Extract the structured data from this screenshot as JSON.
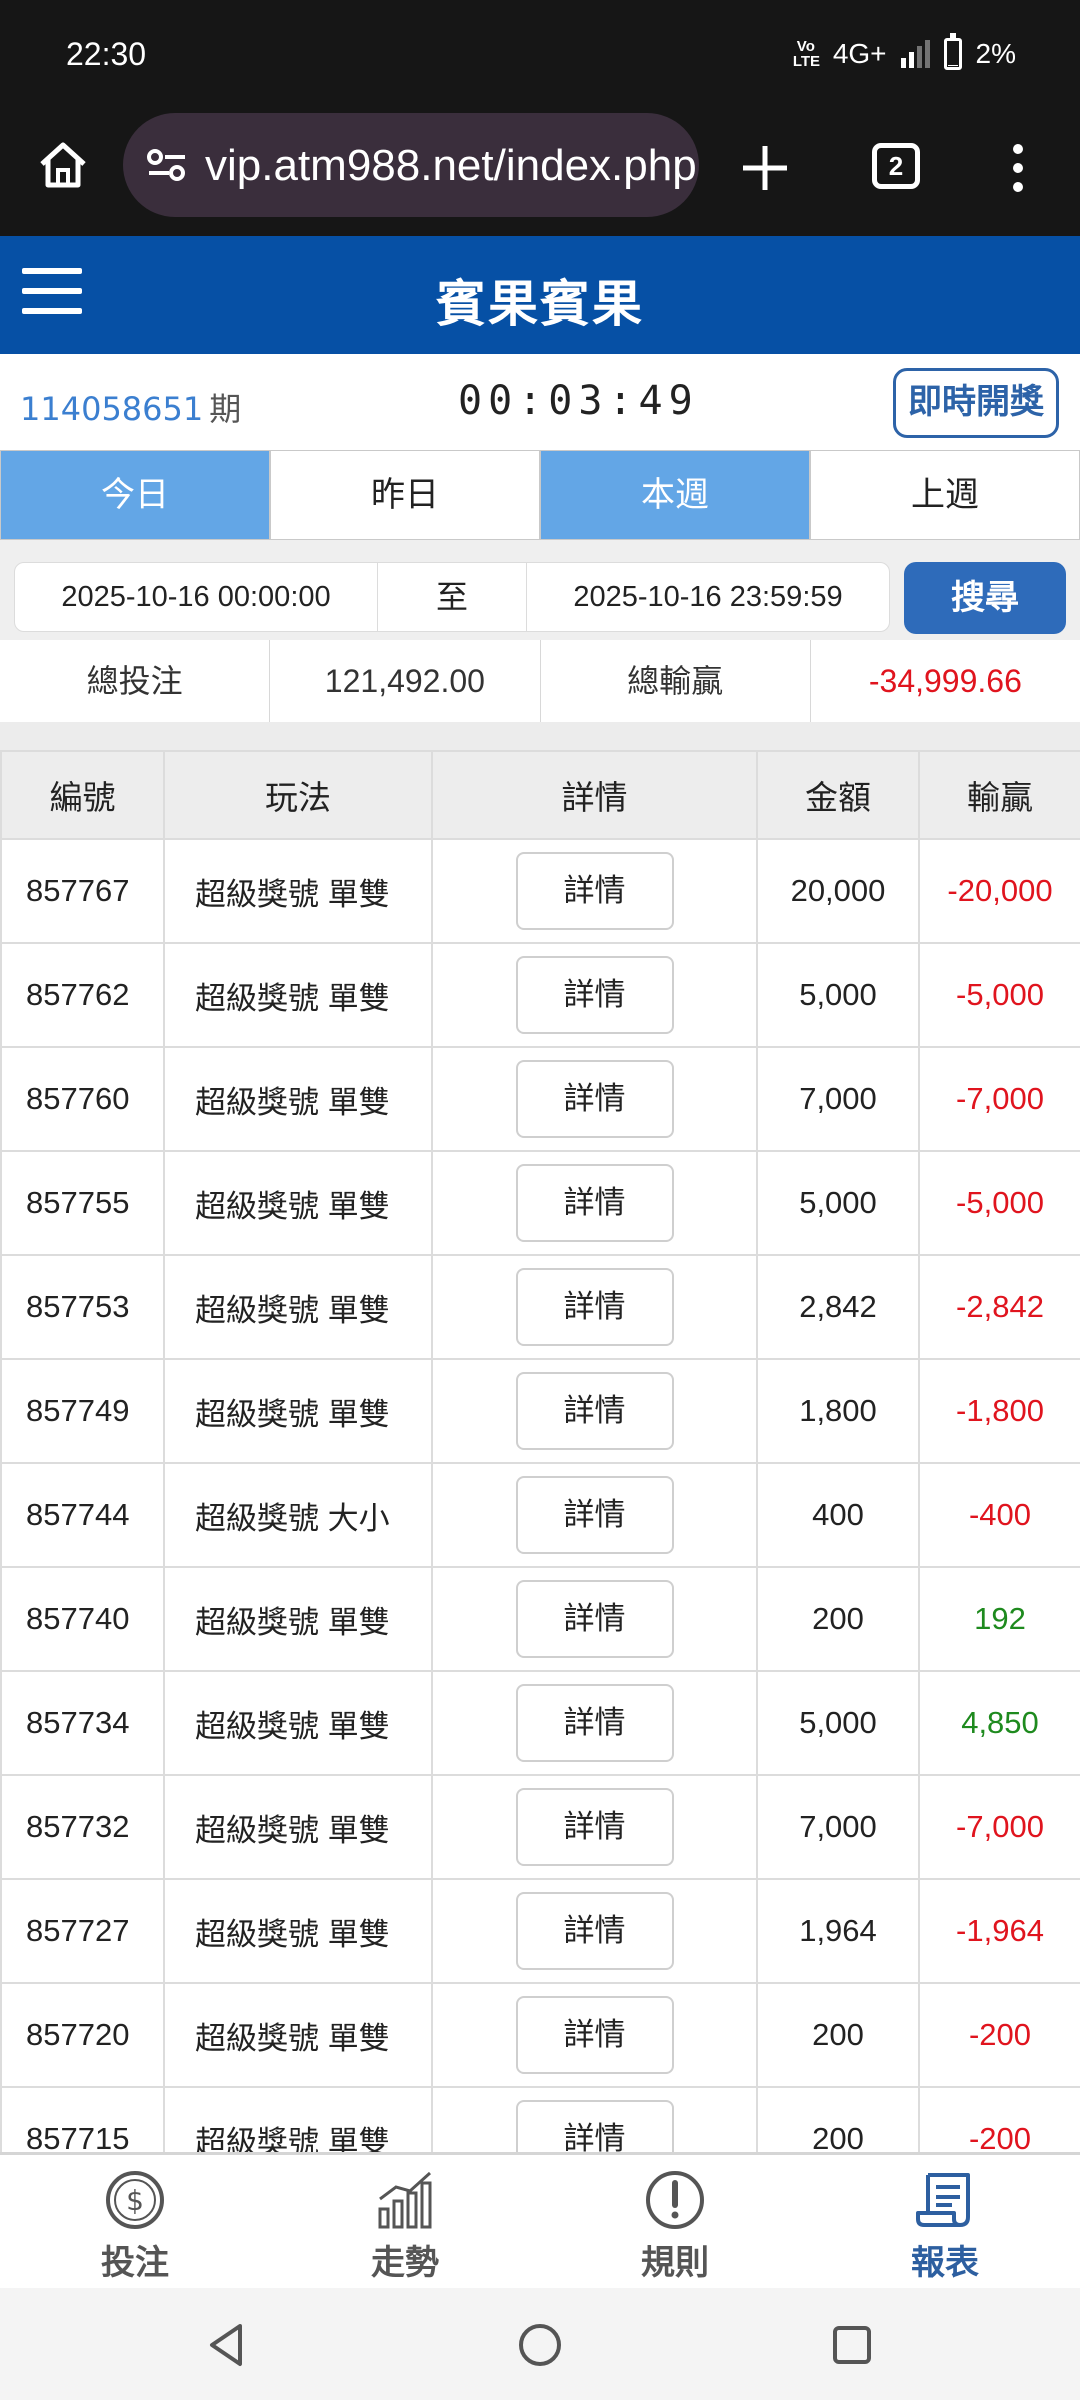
{
  "status_bar": {
    "time": "22:30",
    "volte": "Vo LTE",
    "network": "4G+",
    "battery": "2%",
    "battery_level": 0.02
  },
  "browser": {
    "url": "vip.atm988.net/index.php",
    "tab_count": "2",
    "icons": [
      "home-icon",
      "site-settings-icon",
      "plus-icon",
      "tab-switcher-icon",
      "more-vert-icon"
    ]
  },
  "app": {
    "title": "賓果賓果",
    "menu_icon": "hamburger-icon"
  },
  "period": {
    "number": "114058651",
    "unit": "期",
    "countdown": "00:03:49",
    "live_button": "即時開獎"
  },
  "day_tabs": [
    {
      "label": "今日",
      "active": true
    },
    {
      "label": "昨日",
      "active": false
    },
    {
      "label": "本週",
      "active": true
    },
    {
      "label": "上週",
      "active": false
    }
  ],
  "search": {
    "start": "2025-10-16 00:00:00",
    "separator": "至",
    "end": "2025-10-16 23:59:59",
    "button": "搜尋"
  },
  "summary": {
    "total_bet_label": "總投注",
    "total_bet_value": "121,492.00",
    "total_win_label": "總輸贏",
    "total_win_value": "-34,999.66"
  },
  "table": {
    "headers": [
      "編號",
      "玩法",
      "詳情",
      "金額",
      "輸贏"
    ],
    "detail_label": "詳情",
    "rows": [
      {
        "id": "857767",
        "play": "超級獎號 單雙",
        "amount": "20,000",
        "result": "-20,000",
        "negative": true
      },
      {
        "id": "857762",
        "play": "超級獎號 單雙",
        "amount": "5,000",
        "result": "-5,000",
        "negative": true
      },
      {
        "id": "857760",
        "play": "超級獎號 單雙",
        "amount": "7,000",
        "result": "-7,000",
        "negative": true
      },
      {
        "id": "857755",
        "play": "超級獎號 單雙",
        "amount": "5,000",
        "result": "-5,000",
        "negative": true
      },
      {
        "id": "857753",
        "play": "超級獎號 單雙",
        "amount": "2,842",
        "result": "-2,842",
        "negative": true
      },
      {
        "id": "857749",
        "play": "超級獎號 單雙",
        "amount": "1,800",
        "result": "-1,800",
        "negative": true
      },
      {
        "id": "857744",
        "play": "超級獎號 大小",
        "amount": "400",
        "result": "-400",
        "negative": true
      },
      {
        "id": "857740",
        "play": "超級獎號 單雙",
        "amount": "200",
        "result": "192",
        "negative": false
      },
      {
        "id": "857734",
        "play": "超級獎號 單雙",
        "amount": "5,000",
        "result": "4,850",
        "negative": false
      },
      {
        "id": "857732",
        "play": "超級獎號 單雙",
        "amount": "7,000",
        "result": "-7,000",
        "negative": true
      },
      {
        "id": "857727",
        "play": "超級獎號 單雙",
        "amount": "1,964",
        "result": "-1,964",
        "negative": true
      },
      {
        "id": "857720",
        "play": "超級獎號 單雙",
        "amount": "200",
        "result": "-200",
        "negative": true
      },
      {
        "id": "857715",
        "play": "超級獎號 單雙",
        "amount": "200",
        "result": "-200",
        "negative": true
      }
    ]
  },
  "bottom_nav": [
    {
      "label": "投注",
      "icon": "dollar-coin-icon",
      "active": false
    },
    {
      "label": "走勢",
      "icon": "bar-chart-icon",
      "active": false
    },
    {
      "label": "規則",
      "icon": "exclamation-icon",
      "active": false
    },
    {
      "label": "報表",
      "icon": "report-scroll-icon",
      "active": true
    }
  ],
  "colors": {
    "header_blue": "#0650a5",
    "tab_active": "#63a6e6",
    "search_button": "#2e6bba",
    "negative": "#e0141e",
    "positive": "#1e8a1e",
    "period_number": "#3b7fd0"
  }
}
